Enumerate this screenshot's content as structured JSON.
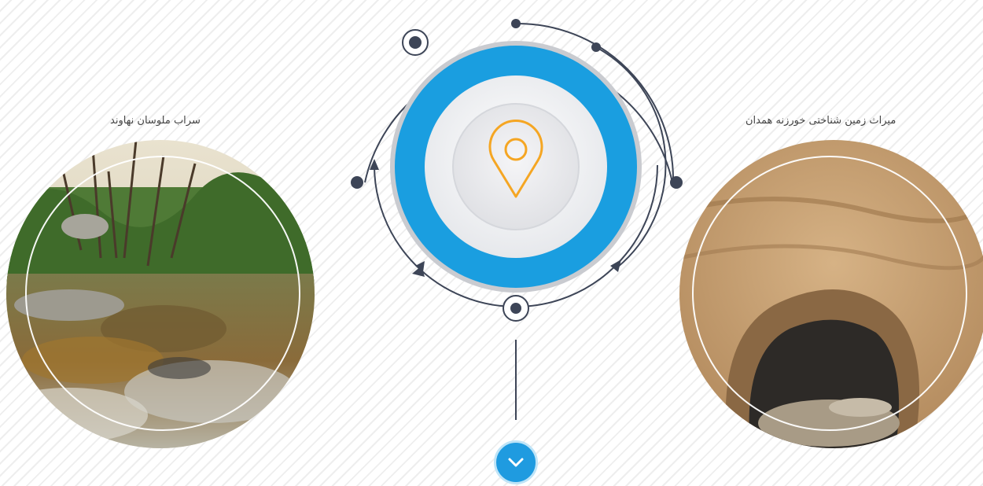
{
  "left_card": {
    "caption": "سراب ملوسان نهاوند"
  },
  "right_card": {
    "caption": "میراث زمین شناختی خورزنه همدان"
  },
  "hub": {
    "icon": "map-pin-icon"
  },
  "scroll_button": {
    "icon": "chevron-down-icon"
  },
  "colors": {
    "accent": "#1a9ee0",
    "pin": "#f5a623",
    "line": "#3d4557"
  }
}
